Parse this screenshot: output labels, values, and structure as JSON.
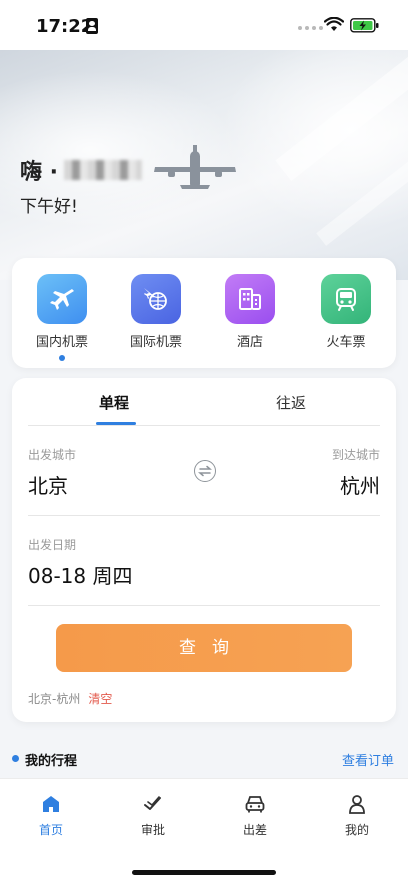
{
  "status_bar": {
    "time": "17:22"
  },
  "hero": {
    "greeting": "嗨 ·",
    "subtitle": "下午好!"
  },
  "services": [
    {
      "label": "国内机票",
      "icon": "airplane-icon",
      "color": "#4aa3f2",
      "active": true
    },
    {
      "label": "国际机票",
      "icon": "globe-plane-icon",
      "color": "#4e6fe6",
      "active": false
    },
    {
      "label": "酒店",
      "icon": "hotel-icon",
      "color": "#a557f0",
      "active": false
    },
    {
      "label": "火车票",
      "icon": "train-icon",
      "color": "#3fbf83",
      "active": false
    }
  ],
  "search": {
    "tabs": [
      "单程",
      "往返"
    ],
    "departure_caption": "出发城市",
    "departure_city": "北京",
    "arrival_caption": "到达城市",
    "arrival_city": "杭州",
    "date_caption": "出发日期",
    "date_value": "08-18 周四",
    "query_label": "查询",
    "history_route": "北京-杭州",
    "history_clear": "清空"
  },
  "trips": {
    "title": "我的行程",
    "view_orders": "查看订单"
  },
  "bottom_nav": [
    {
      "label": "首页",
      "icon": "home-icon",
      "active": true
    },
    {
      "label": "审批",
      "icon": "approve-icon",
      "active": false
    },
    {
      "label": "出差",
      "icon": "car-icon",
      "active": false
    },
    {
      "label": "我的",
      "icon": "profile-icon",
      "active": false
    }
  ],
  "colors": {
    "accent": "#2f7fe0",
    "query_button": "#f59a4a",
    "clear_link": "#e35b4e"
  }
}
